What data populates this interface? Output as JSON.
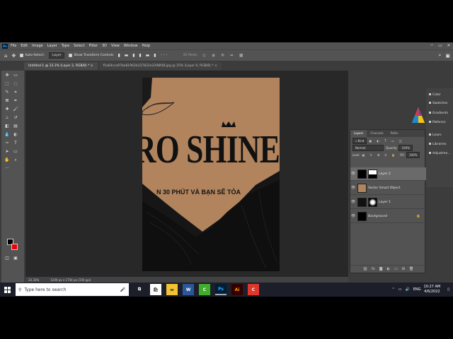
{
  "menu": {
    "app_logo": "Ps",
    "items": [
      "File",
      "Edit",
      "Image",
      "Layer",
      "Type",
      "Select",
      "Filter",
      "3D",
      "View",
      "Window",
      "Help"
    ]
  },
  "options": {
    "auto_select": "Auto-Select:",
    "target": "Layer",
    "transform": "Show Transform Controls",
    "mode3d": "3D Mode:"
  },
  "tabs": [
    {
      "label": "Untitled-1 @ 33.3% (Layer 2, RGB/8) *"
    },
    {
      "label": "f5a64cca97be81962b337822e2298f48.jpg @ 25% (Layer 0, RGB/8) *"
    }
  ],
  "canvas": {
    "title": "RO SHINE",
    "subtitle": "N 30 PHÚT VÀ BẠN SẼ TỎA"
  },
  "status": {
    "zoom": "33.33%",
    "size": "1240 px x 1754 px (150 ppi)"
  },
  "layers": {
    "tabs": [
      "Layers",
      "Channels",
      "Paths"
    ],
    "kind": "Kind",
    "blend": "Normal",
    "opacity_label": "Opacity:",
    "opacity": "100%",
    "lock_label": "Lock:",
    "fill_label": "Fill:",
    "fill": "100%",
    "items": [
      {
        "name": "Layer 2"
      },
      {
        "name": "Vector Smart Object"
      },
      {
        "name": "Layer 1"
      },
      {
        "name": "Background"
      }
    ]
  },
  "side_panels": [
    "Color",
    "Swatches",
    "Gradients",
    "Patterns",
    "Learn",
    "Libraries",
    "Adjustme..."
  ],
  "taskbar": {
    "search_placeholder": "Type here to search",
    "lang": "ENG",
    "time": "10:27 AM",
    "date": "4/6/2022",
    "apps": [
      "store",
      "explorer",
      "word",
      "camtasia",
      "photoshop",
      "illustrator",
      "camtasia-recorder"
    ]
  },
  "colors": {
    "accent_red": "#e60000",
    "paper": "#b1845e",
    "ps_blue": "#31a8ff"
  }
}
